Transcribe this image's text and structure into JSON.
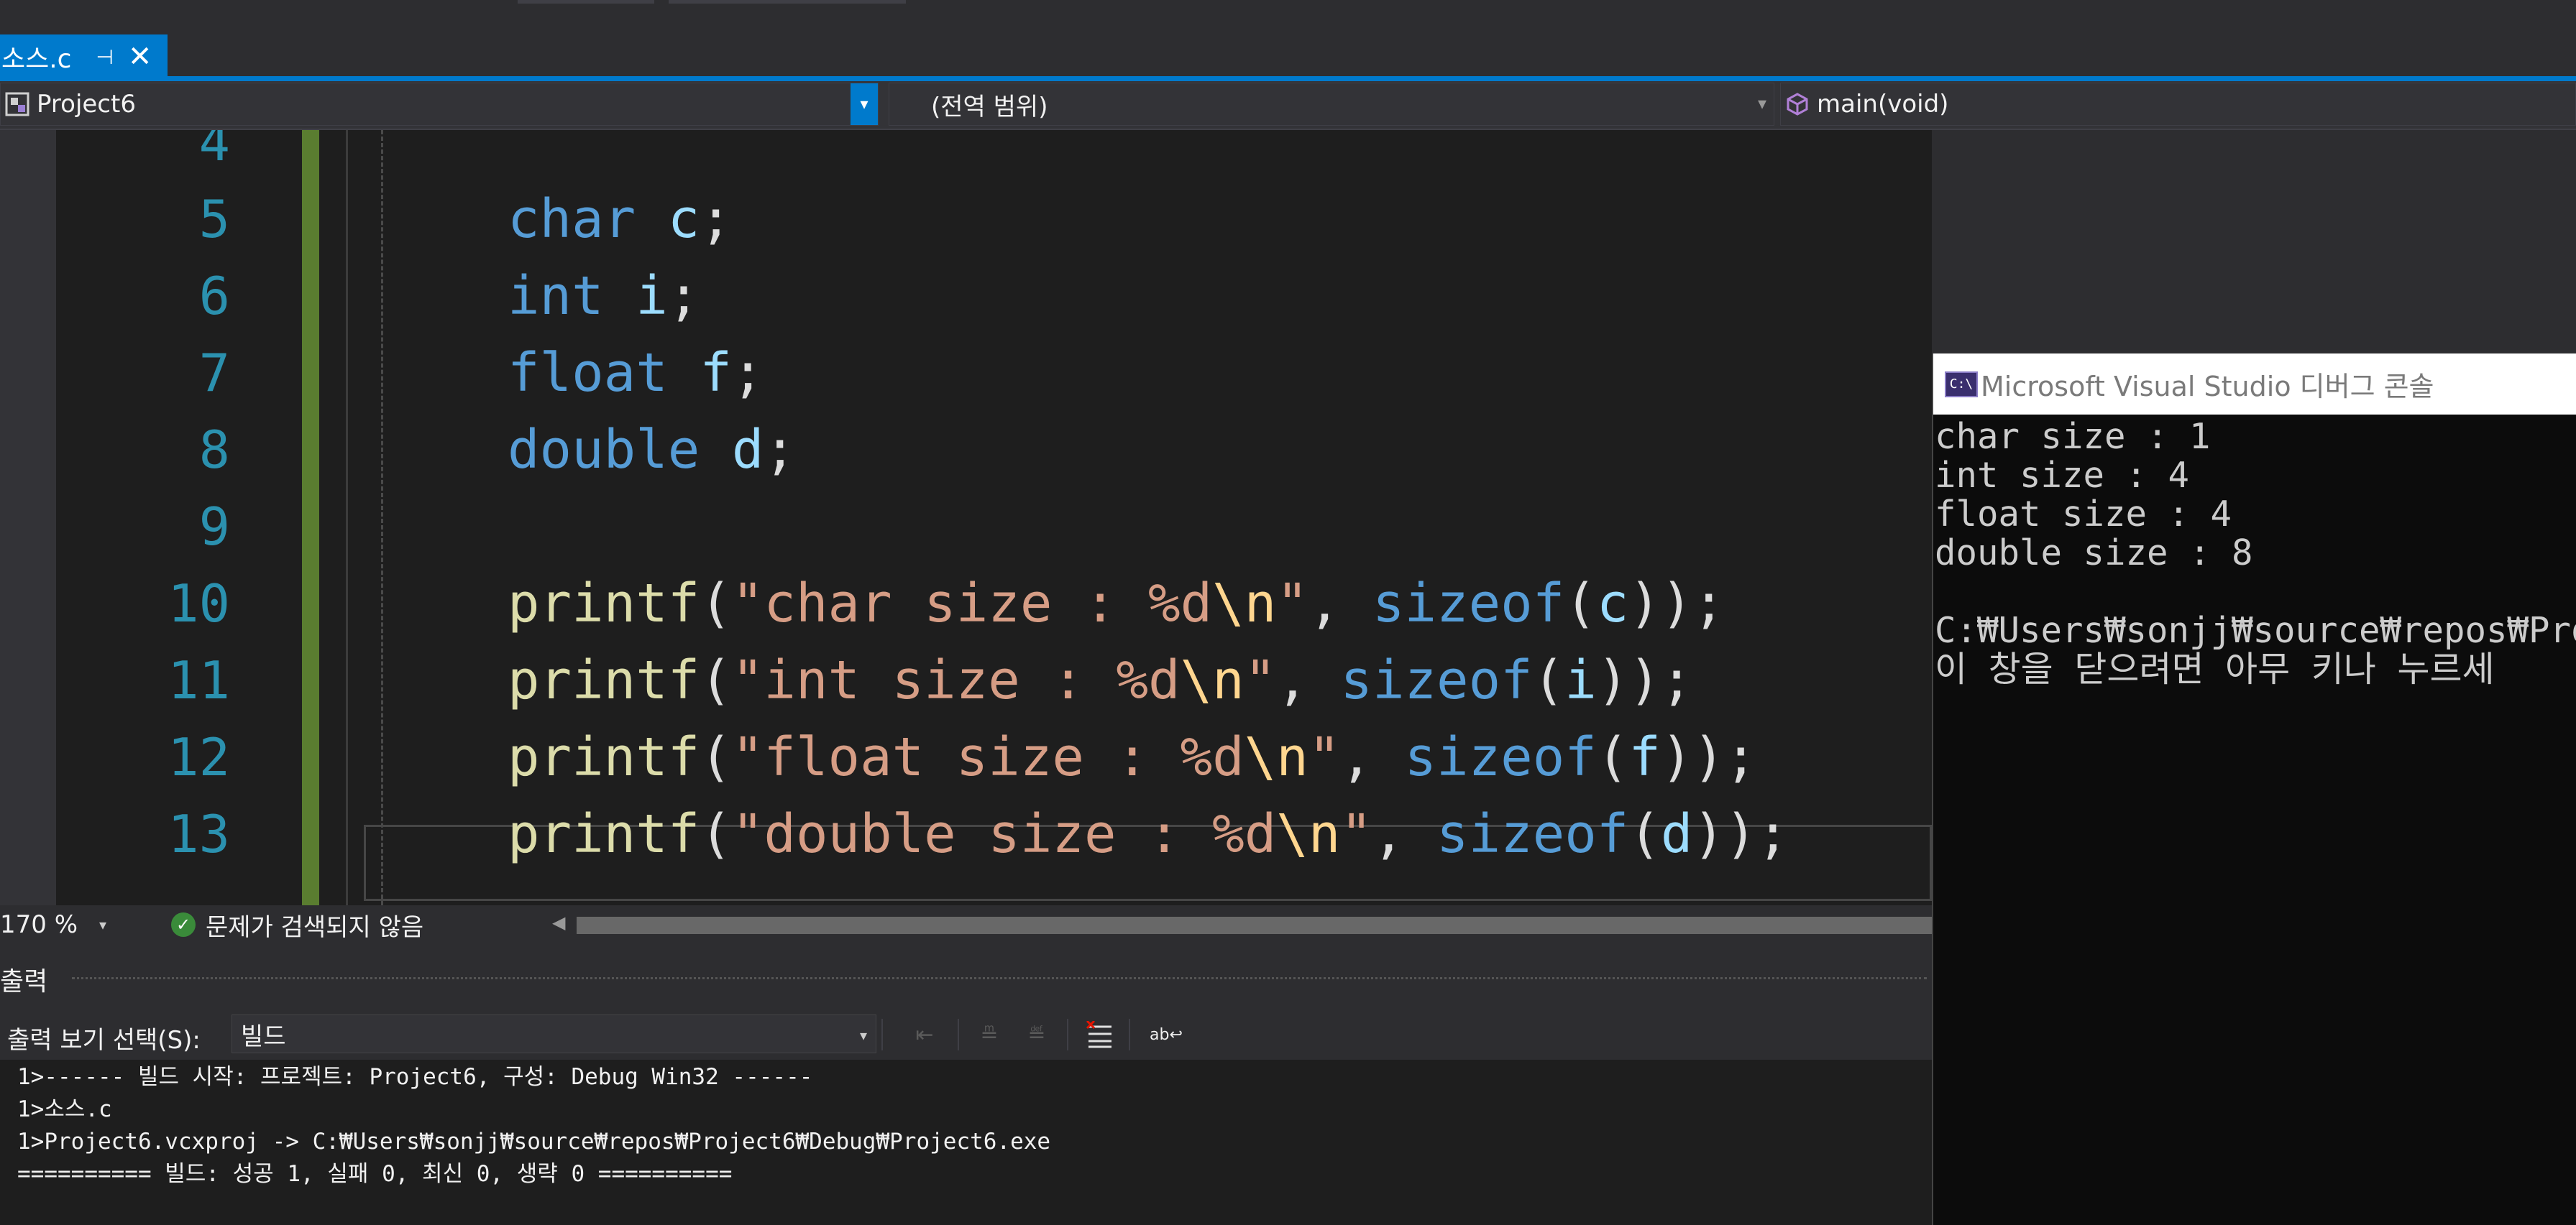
{
  "tab": {
    "label": "소스.c",
    "pin": "⊣",
    "close": "✕"
  },
  "navbar": {
    "project": "Project6",
    "scope": "(전역 범위)",
    "member": "main(void)"
  },
  "editor": {
    "line_numbers": [
      "4",
      "5",
      "6",
      "7",
      "8",
      "9",
      "10",
      "11",
      "12",
      "13"
    ],
    "lines": [
      [],
      [
        {
          "t": "char",
          "c": "kw"
        },
        {
          "t": " "
        },
        {
          "t": "c",
          "c": "var"
        },
        {
          "t": ";"
        }
      ],
      [
        {
          "t": "int",
          "c": "kw"
        },
        {
          "t": " "
        },
        {
          "t": "i",
          "c": "var"
        },
        {
          "t": ";"
        }
      ],
      [
        {
          "t": "float",
          "c": "kw"
        },
        {
          "t": " "
        },
        {
          "t": "f",
          "c": "var"
        },
        {
          "t": ";"
        }
      ],
      [
        {
          "t": "double",
          "c": "kw"
        },
        {
          "t": " "
        },
        {
          "t": "d",
          "c": "var"
        },
        {
          "t": ";"
        }
      ],
      [],
      [
        {
          "t": "printf",
          "c": "fn"
        },
        {
          "t": "("
        },
        {
          "t": "\"char size : %d",
          "c": "str"
        },
        {
          "t": "\\n",
          "c": "esc"
        },
        {
          "t": "\"",
          "c": "str"
        },
        {
          "t": ", "
        },
        {
          "t": "sizeof",
          "c": "kw"
        },
        {
          "t": "("
        },
        {
          "t": "c",
          "c": "var"
        },
        {
          "t": "));"
        }
      ],
      [
        {
          "t": "printf",
          "c": "fn"
        },
        {
          "t": "("
        },
        {
          "t": "\"int size : %d",
          "c": "str"
        },
        {
          "t": "\\n",
          "c": "esc"
        },
        {
          "t": "\"",
          "c": "str"
        },
        {
          "t": ", "
        },
        {
          "t": "sizeof",
          "c": "kw"
        },
        {
          "t": "("
        },
        {
          "t": "i",
          "c": "var"
        },
        {
          "t": "));"
        }
      ],
      [
        {
          "t": "printf",
          "c": "fn"
        },
        {
          "t": "("
        },
        {
          "t": "\"float size : %d",
          "c": "str"
        },
        {
          "t": "\\n",
          "c": "esc"
        },
        {
          "t": "\"",
          "c": "str"
        },
        {
          "t": ", "
        },
        {
          "t": "sizeof",
          "c": "kw"
        },
        {
          "t": "("
        },
        {
          "t": "f",
          "c": "var"
        },
        {
          "t": "));"
        }
      ],
      [
        {
          "t": "printf",
          "c": "fn"
        },
        {
          "t": "("
        },
        {
          "t": "\"double size : %d",
          "c": "str"
        },
        {
          "t": "\\n",
          "c": "esc"
        },
        {
          "t": "\"",
          "c": "str"
        },
        {
          "t": ", "
        },
        {
          "t": "sizeof",
          "c": "kw"
        },
        {
          "t": "("
        },
        {
          "t": "d",
          "c": "var"
        },
        {
          "t": "));"
        }
      ]
    ],
    "zoom": "170 %",
    "issues": "문제가 검색되지 않음"
  },
  "output": {
    "title": "출력",
    "show_label": "출력 보기 선택(S):",
    "show_value": "빌드",
    "lines": [
      "1>------ 빌드 시작: 프로젝트: Project6, 구성: Debug Win32 ------",
      "1>소스.c",
      "1>Project6.vcxproj -> C:₩Users₩sonjj₩source₩repos₩Project6₩Debug₩Project6.exe",
      "========== 빌드: 성공 1, 실패 0, 최신 0, 생략 0 =========="
    ]
  },
  "console": {
    "icon_text": "C:\\",
    "title": "Microsoft Visual Studio 디버그 콘솔",
    "lines": [
      "char size : 1",
      "int size : 4",
      "float size : 4",
      "double size : 8",
      "",
      "C:₩Users₩sonjj₩source₩repos₩Proje",
      "이 창을 닫으려면 아무 키나 누르세"
    ]
  },
  "icons": {
    "project": "project-icon",
    "member": "method-cube-icon",
    "issues": "checkmark-ok-icon",
    "toolbar": [
      "go-to-line-icon",
      "previous-message-icon",
      "next-message-icon",
      "clear-all-icon",
      "word-wrap-icon"
    ]
  }
}
